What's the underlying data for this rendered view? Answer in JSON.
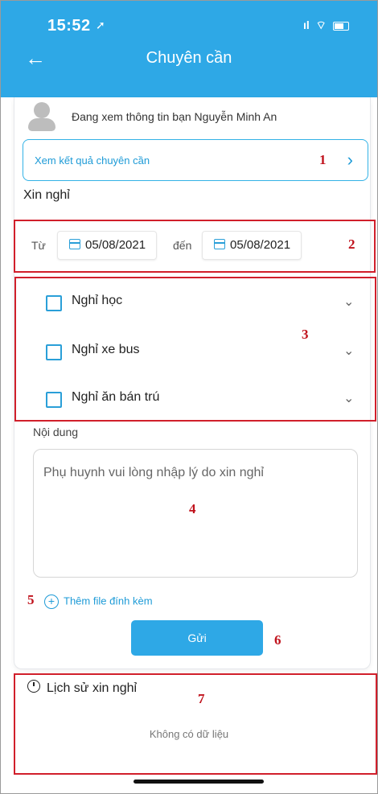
{
  "status_bar": {
    "time": "15:52",
    "signal": "ıl",
    "wifi": "⌔"
  },
  "header": {
    "title": "Chuyên cần"
  },
  "student": {
    "viewing_text": "Đang xem thông tin bạn Nguyễn Minh An"
  },
  "attendance_result": {
    "label": "Xem kết quả chuyên cần"
  },
  "leave": {
    "section_title": "Xin nghỉ",
    "from_label": "Từ",
    "to_label": "đến",
    "from_date": "05/08/2021",
    "to_date": "05/08/2021",
    "options": [
      {
        "label": "Nghỉ học",
        "checked": false
      },
      {
        "label": "Nghỉ xe bus",
        "checked": false
      },
      {
        "label": "Nghỉ ăn bán trú",
        "checked": false
      }
    ],
    "content_label": "Nội dung",
    "content_placeholder": "Phụ huynh vui lòng nhập lý do xin nghỉ",
    "attach_label": "Thêm file đính kèm",
    "submit_label": "Gửi"
  },
  "history": {
    "title": "Lịch sử xin nghỉ",
    "empty_text": "Không có dữ liệu"
  },
  "annotations": [
    "1",
    "2",
    "3",
    "4",
    "5",
    "6",
    "7"
  ],
  "colors": {
    "primary": "#2ea8e6",
    "annotation": "#d11f2b"
  }
}
